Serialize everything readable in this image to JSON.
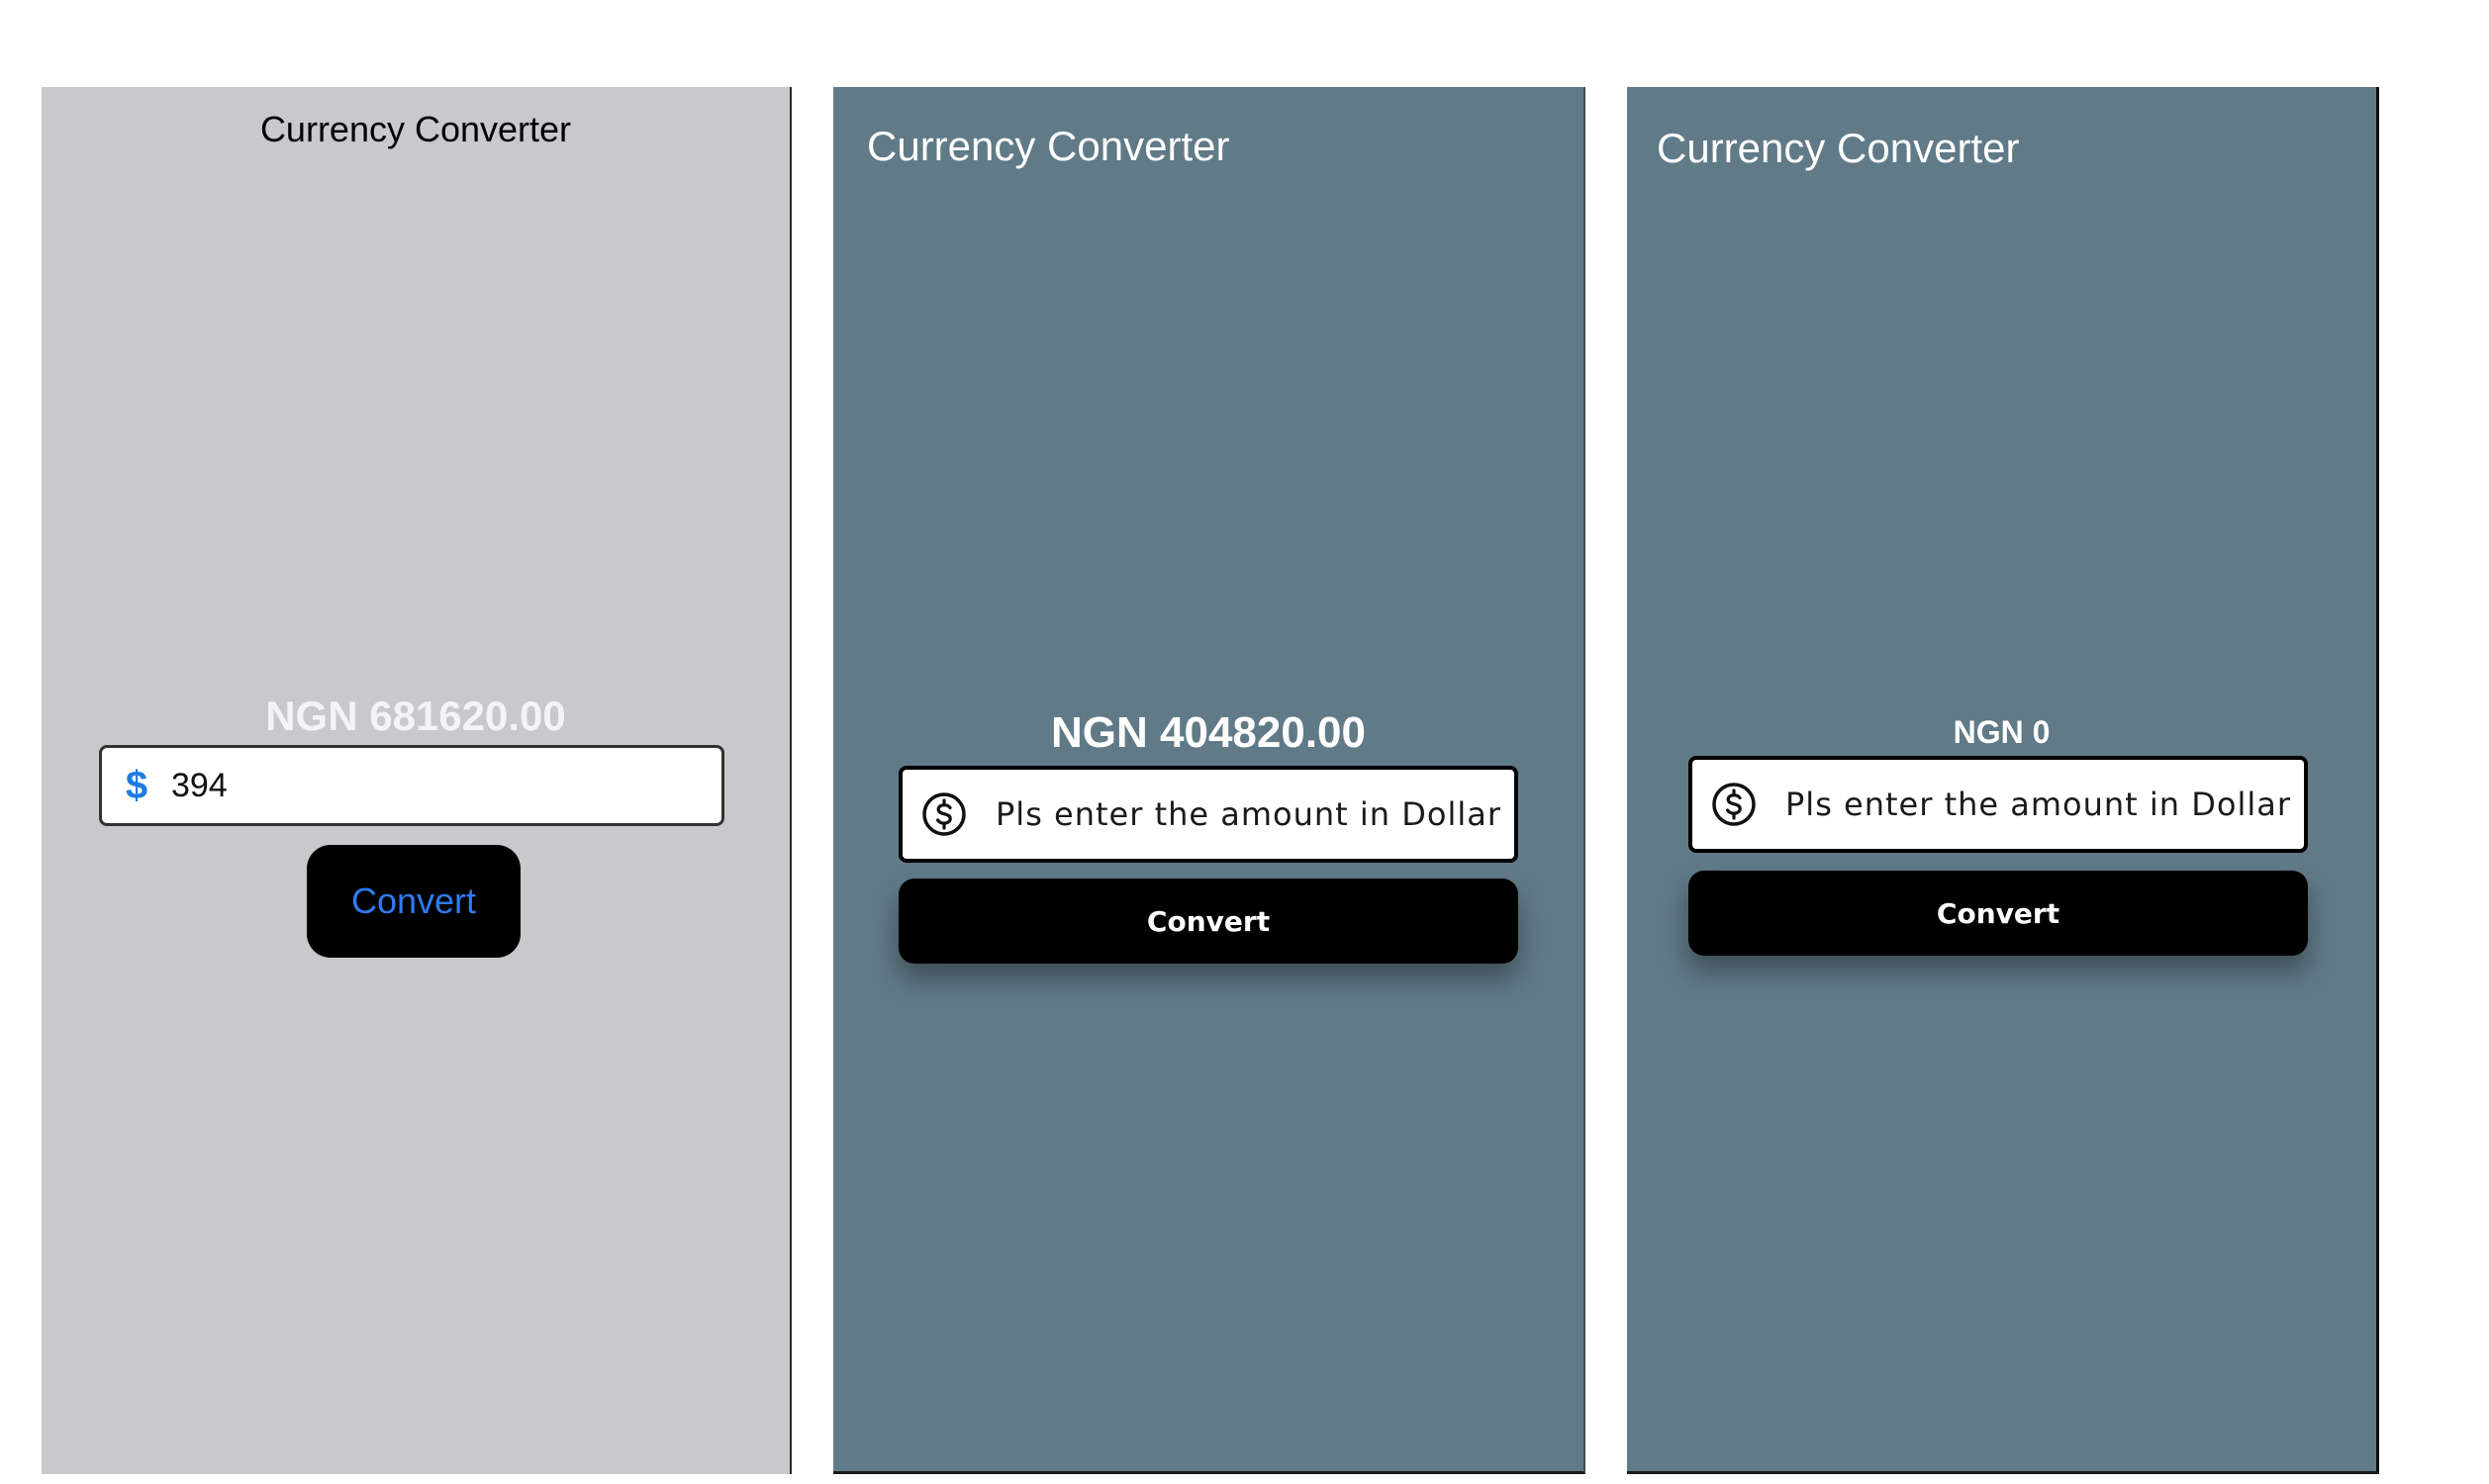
{
  "screens": [
    {
      "title": "Currency Converter",
      "result": "NGN 681620.00",
      "input_value": "394",
      "input_icon": "dollar-sign-icon",
      "button_label": "Convert",
      "background": "#c8c8cd",
      "button_text_color": "#2d7bf0"
    },
    {
      "title": "Currency Converter",
      "result": "NGN 404820.00",
      "input_placeholder": "Pls enter the amount in Dollar",
      "input_icon": "dollar-circle-icon",
      "button_label": "Convert",
      "background": "#607a87"
    },
    {
      "title": "Currency Converter",
      "result": "NGN 0",
      "input_placeholder": "Pls enter the amount in Dollar",
      "input_icon": "dollar-circle-icon",
      "button_label": "Convert",
      "background": "#607a87"
    }
  ]
}
